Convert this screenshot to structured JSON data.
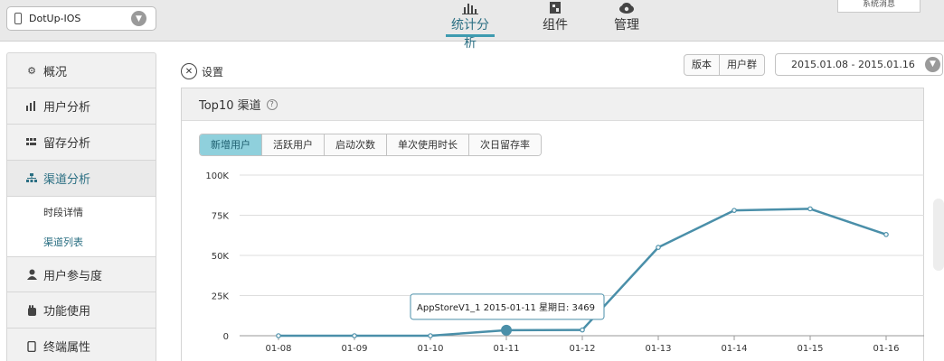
{
  "app_select": {
    "value": "DotUp-IOS"
  },
  "nav": [
    {
      "label": "统计分析",
      "icon": "bar-chart-icon",
      "active": true
    },
    {
      "label": "组件",
      "icon": "component-icon",
      "active": false
    },
    {
      "label": "管理",
      "icon": "cloud-gear-icon",
      "active": false
    }
  ],
  "system_message": "系统消息",
  "sidebar": {
    "items": [
      {
        "label": "概况",
        "icon": "gear-icon"
      },
      {
        "label": "用户分析",
        "icon": "bar-chart-icon"
      },
      {
        "label": "留存分析",
        "icon": "grid-icon"
      },
      {
        "label": "渠道分析",
        "icon": "sitemap-icon",
        "active": true
      },
      {
        "label": "用户参与度",
        "icon": "user-icon"
      },
      {
        "label": "功能使用",
        "icon": "hand-icon"
      },
      {
        "label": "终端属性",
        "icon": "device-icon"
      }
    ],
    "sub_items": [
      {
        "label": "时段详情",
        "active": false
      },
      {
        "label": "渠道列表",
        "active": true
      }
    ]
  },
  "settings_label": "设置",
  "filters": {
    "version": "版本",
    "user_group": "用户群"
  },
  "date_range": "2015.01.08 - 2015.01.16",
  "panel": {
    "title": "Top10 渠道",
    "tabs": [
      "新增用户",
      "活跃用户",
      "启动次数",
      "单次使用时长",
      "次日留存率"
    ],
    "active_tab": 0
  },
  "tooltip": {
    "text": "AppStoreV1_1 2015-01-11 星期日: 3469"
  },
  "colors": {
    "accent": "#3e9bb0",
    "line": "#4a8fa9",
    "active_tab": "#8fd0dc"
  },
  "chart_data": {
    "type": "line",
    "x": [
      "01-08",
      "01-09",
      "01-10",
      "01-11",
      "01-12",
      "01-13",
      "01-14",
      "01-15",
      "01-16"
    ],
    "series": [
      {
        "name": "AppStoreV1_1",
        "values": [
          0,
          0,
          0,
          3469,
          3600,
          55000,
          78000,
          79000,
          63000
        ]
      }
    ],
    "yticks": [
      "0",
      "25K",
      "50K",
      "75K",
      "100K"
    ],
    "ylim": [
      0,
      100000
    ],
    "grid": true,
    "highlight_index": 3
  }
}
